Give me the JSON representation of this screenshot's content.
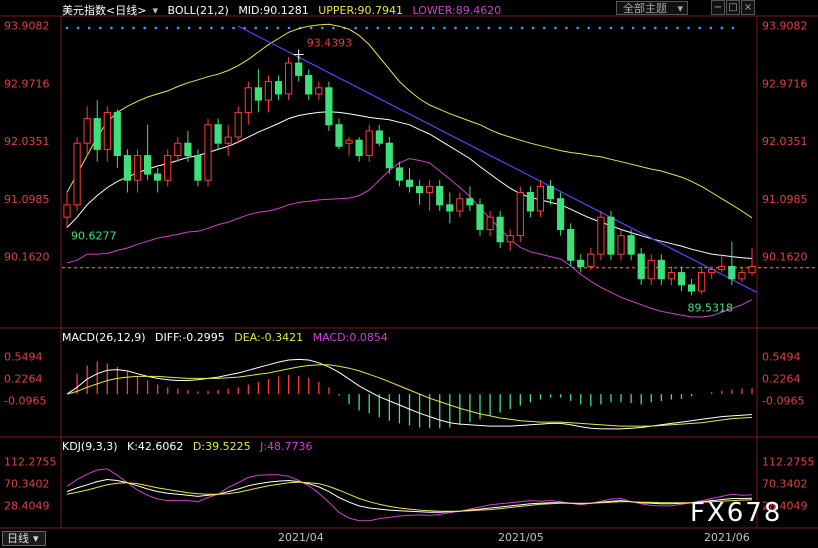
{
  "header": {
    "instrument": "美元指数",
    "period_tag": "<日线>",
    "boll_label": "BOLL(21,2)",
    "mid_text": "MID:90.1281",
    "upper_text": "UPPER:90.7941",
    "lower_text": "LOWER:89.4620"
  },
  "toolbar": {
    "theme_label": "全部主题"
  },
  "macd_header": {
    "label": "MACD(26,12,9)",
    "diff_text": "DIFF:-0.2995",
    "dea_text": "DEA:-0.3421",
    "macd_text": "MACD:0.0854"
  },
  "kdj_header": {
    "label": "KDJ(9,3,3)",
    "k_text": "K:42.6062",
    "d_text": "D:39.5225",
    "j_text": "J:48.7736"
  },
  "footer": {
    "period_tab": "日线",
    "dates": [
      "2021/04",
      "2021/05",
      "2021/06"
    ],
    "watermark": "FX678"
  },
  "colors": {
    "up": "#ff3b3b",
    "down": "#3ee07a",
    "mid": "#ffffff",
    "upper": "#e6e64a",
    "lower": "#d040d0",
    "trendline": "#6040ff",
    "axis_text": "#e04040",
    "last_price": "#ff8c1a"
  },
  "chart_data": {
    "type": "candlestick",
    "y_ticks_main": [
      93.9082,
      92.9716,
      92.0351,
      91.0985,
      90.162
    ],
    "y_range_main": [
      89.05,
      94.0
    ],
    "last_price": 89.98,
    "annotations": {
      "high": "93.4393",
      "low": "89.5318",
      "start": "90.6277"
    },
    "candles": [
      [
        90.8,
        91.2,
        90.63,
        91.0
      ],
      [
        91.0,
        92.1,
        90.9,
        92.0
      ],
      [
        92.0,
        92.6,
        91.8,
        92.4
      ],
      [
        92.4,
        92.7,
        91.7,
        91.9
      ],
      [
        91.9,
        92.6,
        91.7,
        92.5
      ],
      [
        92.5,
        92.55,
        91.6,
        91.8
      ],
      [
        91.8,
        91.9,
        91.2,
        91.4
      ],
      [
        91.4,
        91.9,
        91.2,
        91.8
      ],
      [
        91.8,
        92.3,
        91.4,
        91.5
      ],
      [
        91.5,
        91.6,
        91.2,
        91.4
      ],
      [
        91.4,
        91.9,
        91.3,
        91.8
      ],
      [
        91.8,
        92.1,
        91.7,
        92.0
      ],
      [
        92.0,
        92.2,
        91.7,
        91.8
      ],
      [
        91.8,
        91.9,
        91.3,
        91.4
      ],
      [
        91.4,
        92.4,
        91.3,
        92.3
      ],
      [
        92.3,
        92.4,
        91.9,
        92.0
      ],
      [
        92.0,
        92.3,
        91.8,
        92.1
      ],
      [
        92.1,
        92.6,
        92.0,
        92.5
      ],
      [
        92.5,
        93.0,
        92.3,
        92.9
      ],
      [
        92.9,
        93.2,
        92.5,
        92.7
      ],
      [
        92.7,
        93.1,
        92.5,
        93.0
      ],
      [
        93.0,
        93.1,
        92.7,
        92.8
      ],
      [
        92.8,
        93.4,
        92.7,
        93.3
      ],
      [
        93.3,
        93.44,
        93.0,
        93.1
      ],
      [
        93.1,
        93.2,
        92.7,
        92.8
      ],
      [
        92.8,
        93.0,
        92.7,
        92.9
      ],
      [
        92.9,
        93.0,
        92.2,
        92.3
      ],
      [
        92.3,
        92.4,
        91.9,
        91.95
      ],
      [
        92.0,
        92.1,
        91.8,
        92.05
      ],
      [
        92.05,
        92.1,
        91.7,
        91.8
      ],
      [
        91.8,
        92.3,
        91.7,
        92.2
      ],
      [
        92.2,
        92.3,
        91.95,
        92.0
      ],
      [
        92.0,
        92.1,
        91.5,
        91.6
      ],
      [
        91.6,
        91.7,
        91.3,
        91.4
      ],
      [
        91.4,
        91.6,
        91.2,
        91.3
      ],
      [
        91.3,
        91.4,
        91.0,
        91.2
      ],
      [
        91.2,
        91.4,
        90.9,
        91.3
      ],
      [
        91.3,
        91.4,
        90.9,
        91.0
      ],
      [
        91.0,
        91.2,
        90.7,
        90.9
      ],
      [
        90.9,
        91.2,
        90.8,
        91.1
      ],
      [
        91.1,
        91.3,
        90.9,
        91.0
      ],
      [
        91.0,
        91.1,
        90.5,
        90.6
      ],
      [
        90.6,
        90.9,
        90.5,
        90.8
      ],
      [
        90.8,
        90.9,
        90.3,
        90.4
      ],
      [
        90.4,
        90.6,
        90.25,
        90.5
      ],
      [
        90.5,
        91.3,
        90.4,
        91.2
      ],
      [
        91.2,
        91.3,
        90.8,
        90.9
      ],
      [
        90.9,
        91.4,
        90.8,
        91.3
      ],
      [
        91.3,
        91.4,
        91.0,
        91.1
      ],
      [
        91.1,
        91.2,
        90.5,
        90.6
      ],
      [
        90.6,
        90.7,
        90.0,
        90.1
      ],
      [
        90.1,
        90.2,
        89.9,
        90.0
      ],
      [
        90.0,
        90.3,
        89.95,
        90.2
      ],
      [
        90.2,
        90.9,
        90.1,
        90.8
      ],
      [
        90.8,
        90.9,
        90.1,
        90.2
      ],
      [
        90.2,
        90.6,
        90.1,
        90.5
      ],
      [
        90.5,
        90.6,
        90.1,
        90.2
      ],
      [
        90.2,
        90.3,
        89.7,
        89.8
      ],
      [
        89.8,
        90.2,
        89.7,
        90.1
      ],
      [
        90.1,
        90.2,
        89.7,
        89.8
      ],
      [
        89.8,
        90.0,
        89.7,
        89.9
      ],
      [
        89.9,
        90.0,
        89.6,
        89.7
      ],
      [
        89.7,
        89.8,
        89.53,
        89.6
      ],
      [
        89.6,
        90.0,
        89.55,
        89.9
      ],
      [
        89.9,
        90.0,
        89.8,
        89.95
      ],
      [
        89.95,
        90.2,
        89.9,
        90.0
      ],
      [
        90.0,
        90.4,
        89.7,
        89.8
      ],
      [
        89.8,
        90.0,
        89.75,
        89.9
      ],
      [
        89.9,
        90.3,
        89.85,
        90.0
      ]
    ],
    "boll_mid": [
      90.63,
      90.8,
      91.0,
      91.15,
      91.28,
      91.38,
      91.45,
      91.52,
      91.58,
      91.63,
      91.67,
      91.72,
      91.77,
      91.8,
      91.85,
      91.9,
      91.95,
      92.02,
      92.1,
      92.18,
      92.25,
      92.32,
      92.4,
      92.45,
      92.48,
      92.5,
      92.51,
      92.5,
      92.48,
      92.45,
      92.42,
      92.4,
      92.38,
      92.34,
      92.3,
      92.22,
      92.15,
      92.05,
      91.95,
      91.85,
      91.75,
      91.62,
      91.5,
      91.38,
      91.27,
      91.18,
      91.12,
      91.08,
      91.04,
      91.0,
      90.93,
      90.85,
      90.78,
      90.72,
      90.66,
      90.6,
      90.55,
      90.5,
      90.45,
      90.41,
      90.37,
      90.33,
      90.28,
      90.24,
      90.2,
      90.18,
      90.16,
      90.14,
      90.13
    ],
    "boll_upper": [
      91.2,
      91.5,
      91.8,
      92.1,
      92.35,
      92.5,
      92.6,
      92.68,
      92.75,
      92.8,
      92.85,
      92.92,
      92.98,
      93.03,
      93.08,
      93.12,
      93.18,
      93.26,
      93.36,
      93.48,
      93.6,
      93.7,
      93.8,
      93.86,
      93.9,
      93.92,
      93.93,
      93.9,
      93.85,
      93.75,
      93.6,
      93.4,
      93.2,
      93.0,
      92.85,
      92.72,
      92.62,
      92.55,
      92.48,
      92.42,
      92.36,
      92.3,
      92.22,
      92.15,
      92.1,
      92.05,
      92.0,
      91.96,
      91.92,
      91.88,
      91.85,
      91.83,
      91.8,
      91.78,
      91.74,
      91.7,
      91.66,
      91.62,
      91.58,
      91.55,
      91.5,
      91.45,
      91.38,
      91.3,
      91.2,
      91.1,
      91.0,
      90.9,
      90.79
    ],
    "boll_lower": [
      90.06,
      90.1,
      90.2,
      90.2,
      90.21,
      90.26,
      90.3,
      90.36,
      90.41,
      90.46,
      90.49,
      90.52,
      90.56,
      90.57,
      90.62,
      90.68,
      90.72,
      90.78,
      90.84,
      90.88,
      90.9,
      90.94,
      91.0,
      91.04,
      91.06,
      91.08,
      91.09,
      91.1,
      91.11,
      91.15,
      91.24,
      91.4,
      91.56,
      91.68,
      91.75,
      91.72,
      91.68,
      91.55,
      91.42,
      91.28,
      91.14,
      90.94,
      90.78,
      90.61,
      90.44,
      90.31,
      90.24,
      90.2,
      90.16,
      90.12,
      90.01,
      89.87,
      89.76,
      89.66,
      89.58,
      89.5,
      89.44,
      89.38,
      89.32,
      89.27,
      89.24,
      89.21,
      89.18,
      89.18,
      89.2,
      89.26,
      89.32,
      89.38,
      89.46
    ],
    "trendline": {
      "start": [
        17,
        93.9
      ],
      "end": [
        68,
        89.62
      ]
    },
    "macd": {
      "y_ticks": [
        0.5494,
        0.2264,
        -0.0965
      ],
      "y_range": [
        -0.6,
        0.75
      ],
      "hist": [
        0.0,
        0.3,
        0.42,
        0.48,
        0.45,
        0.4,
        0.33,
        0.26,
        0.2,
        0.14,
        0.1,
        0.08,
        0.06,
        0.04,
        0.05,
        0.06,
        0.08,
        0.1,
        0.14,
        0.18,
        0.22,
        0.26,
        0.28,
        0.27,
        0.24,
        0.18,
        0.1,
        -0.02,
        -0.15,
        -0.24,
        -0.28,
        -0.34,
        -0.39,
        -0.43,
        -0.46,
        -0.49,
        -0.5,
        -0.5,
        -0.49,
        -0.45,
        -0.41,
        -0.37,
        -0.32,
        -0.27,
        -0.22,
        -0.17,
        -0.12,
        -0.08,
        -0.05,
        -0.05,
        -0.1,
        -0.15,
        -0.18,
        -0.15,
        -0.12,
        -0.12,
        -0.13,
        -0.15,
        -0.12,
        -0.1,
        -0.08,
        -0.07,
        -0.03,
        0.0,
        0.03,
        0.05,
        0.07,
        0.08,
        0.0854
      ],
      "diff": [
        0.0,
        0.1,
        0.22,
        0.3,
        0.35,
        0.36,
        0.34,
        0.3,
        0.26,
        0.23,
        0.21,
        0.2,
        0.2,
        0.21,
        0.23,
        0.25,
        0.28,
        0.31,
        0.35,
        0.39,
        0.43,
        0.47,
        0.5,
        0.51,
        0.5,
        0.46,
        0.4,
        0.32,
        0.22,
        0.12,
        0.04,
        -0.04,
        -0.1,
        -0.16,
        -0.22,
        -0.28,
        -0.33,
        -0.38,
        -0.42,
        -0.44,
        -0.45,
        -0.46,
        -0.47,
        -0.47,
        -0.47,
        -0.46,
        -0.45,
        -0.44,
        -0.43,
        -0.43,
        -0.45,
        -0.48,
        -0.5,
        -0.51,
        -0.51,
        -0.51,
        -0.5,
        -0.49,
        -0.47,
        -0.45,
        -0.43,
        -0.41,
        -0.39,
        -0.37,
        -0.35,
        -0.33,
        -0.32,
        -0.31,
        -0.2995
      ],
      "dea": [
        0.0,
        0.04,
        0.1,
        0.15,
        0.2,
        0.23,
        0.25,
        0.26,
        0.26,
        0.26,
        0.25,
        0.24,
        0.23,
        0.23,
        0.23,
        0.23,
        0.24,
        0.25,
        0.27,
        0.29,
        0.31,
        0.34,
        0.37,
        0.4,
        0.42,
        0.43,
        0.43,
        0.41,
        0.38,
        0.34,
        0.29,
        0.24,
        0.18,
        0.12,
        0.06,
        0.0,
        -0.06,
        -0.11,
        -0.16,
        -0.21,
        -0.25,
        -0.29,
        -0.32,
        -0.35,
        -0.37,
        -0.39,
        -0.4,
        -0.41,
        -0.41,
        -0.41,
        -0.42,
        -0.43,
        -0.44,
        -0.45,
        -0.46,
        -0.47,
        -0.47,
        -0.47,
        -0.47,
        -0.46,
        -0.45,
        -0.44,
        -0.43,
        -0.42,
        -0.4,
        -0.38,
        -0.36,
        -0.35,
        -0.3421
      ]
    },
    "kdj": {
      "y_ticks": [
        112.2755,
        70.3402,
        28.4049
      ],
      "y_range": [
        -10,
        130
      ],
      "k": [
        55,
        62,
        68,
        74,
        78,
        76,
        72,
        66,
        60,
        55,
        52,
        50,
        48,
        46,
        48,
        50,
        55,
        60,
        66,
        70,
        73,
        75,
        76,
        74,
        70,
        64,
        55,
        44,
        35,
        28,
        24,
        22,
        20,
        19,
        18,
        17,
        16,
        16,
        17,
        18,
        20,
        22,
        24,
        26,
        28,
        30,
        32,
        33,
        34,
        34,
        33,
        32,
        33,
        35,
        37,
        38,
        36,
        34,
        33,
        32,
        32,
        33,
        34,
        36,
        38,
        40,
        42,
        42,
        42.6
      ],
      "d": [
        50,
        54,
        58,
        63,
        68,
        71,
        72,
        70,
        66,
        62,
        59,
        56,
        53,
        51,
        50,
        50,
        51,
        54,
        58,
        62,
        66,
        69,
        72,
        73,
        72,
        70,
        65,
        58,
        50,
        42,
        36,
        31,
        27,
        24,
        22,
        20,
        19,
        18,
        18,
        18,
        19,
        20,
        21,
        23,
        25,
        27,
        29,
        31,
        32,
        33,
        33,
        33,
        33,
        34,
        35,
        36,
        36,
        35,
        35,
        34,
        34,
        34,
        34,
        35,
        36,
        37,
        38,
        39,
        39.5
      ],
      "j": [
        65,
        78,
        88,
        96,
        98,
        86,
        72,
        58,
        48,
        41,
        38,
        38,
        38,
        36,
        44,
        50,
        63,
        72,
        82,
        86,
        87,
        87,
        84,
        76,
        66,
        52,
        35,
        16,
        5,
        0,
        0,
        4,
        6,
        9,
        10,
        11,
        10,
        12,
        15,
        18,
        22,
        26,
        30,
        32,
        34,
        36,
        38,
        37,
        38,
        36,
        33,
        30,
        33,
        37,
        41,
        42,
        36,
        32,
        29,
        28,
        28,
        31,
        34,
        38,
        42,
        46,
        50,
        48,
        48.8
      ]
    }
  }
}
